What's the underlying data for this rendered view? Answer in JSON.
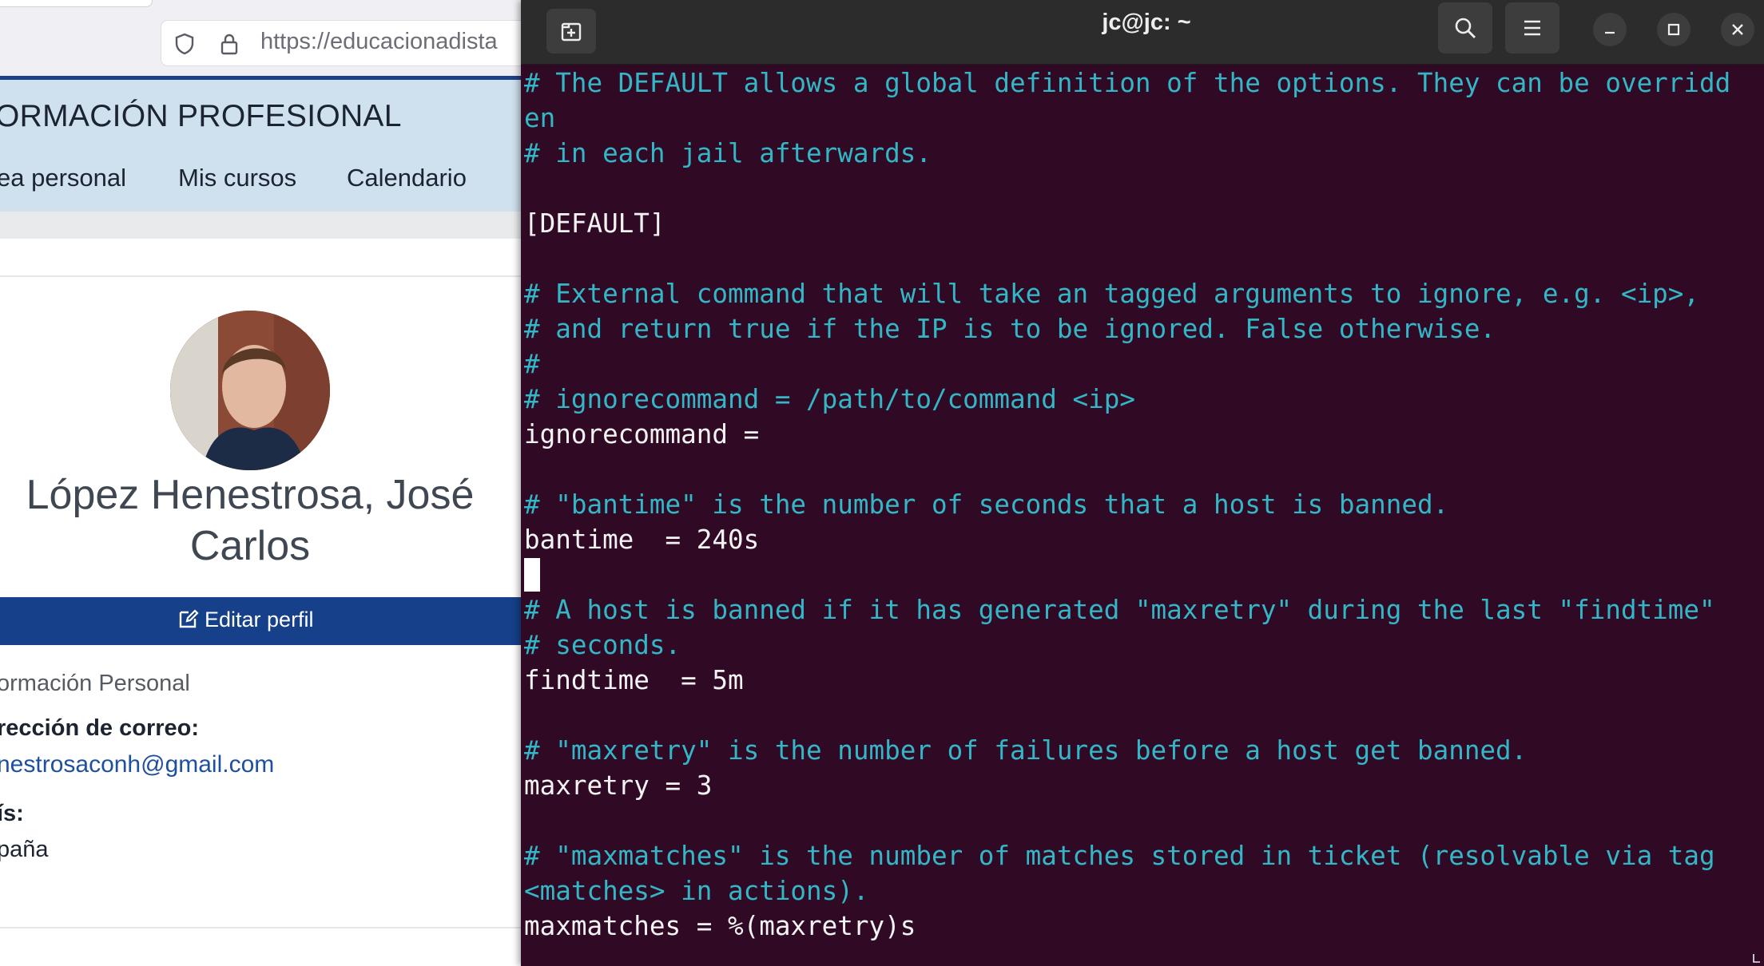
{
  "browser": {
    "url": "https://educacionadista",
    "site_title": "ORMACIÓN PROFESIONAL",
    "nav_items": [
      "ea personal",
      "Mis cursos",
      "Calendario"
    ],
    "profile_name": "López Henestrosa, José Carlos",
    "edit_profile_label": "Editar perfil",
    "section_title": "ormación Personal",
    "email_label": "rección de correo:",
    "email_value": "nestrosaconh@gmail.com",
    "country_label": "ís:",
    "country_value": "paña"
  },
  "terminal": {
    "title": "jc@jc: ~",
    "lines": [
      {
        "text": "# The DEFAULT allows a global definition of the options. They can be overridd",
        "type": "comment"
      },
      {
        "text": "en",
        "type": "comment"
      },
      {
        "text": "# in each jail afterwards.",
        "type": "comment"
      },
      {
        "text": "",
        "type": "blank"
      },
      {
        "text": "[DEFAULT]",
        "type": "text"
      },
      {
        "text": "",
        "type": "blank"
      },
      {
        "text": "# External command that will take an tagged arguments to ignore, e.g. <ip>,",
        "type": "comment"
      },
      {
        "text": "# and return true if the IP is to be ignored. False otherwise.",
        "type": "comment"
      },
      {
        "text": "#",
        "type": "comment"
      },
      {
        "text": "# ignorecommand = /path/to/command <ip>",
        "type": "comment"
      },
      {
        "text": "ignorecommand =",
        "type": "text"
      },
      {
        "text": "",
        "type": "blank"
      },
      {
        "text": "# \"bantime\" is the number of seconds that a host is banned.",
        "type": "comment"
      },
      {
        "text": "bantime  = 240s",
        "type": "text"
      },
      {
        "text": "",
        "type": "cursor"
      },
      {
        "text": "# A host is banned if it has generated \"maxretry\" during the last \"findtime\"",
        "type": "comment"
      },
      {
        "text": "# seconds.",
        "type": "comment"
      },
      {
        "text": "findtime  = 5m",
        "type": "text"
      },
      {
        "text": "",
        "type": "blank"
      },
      {
        "text": "# \"maxretry\" is the number of failures before a host get banned.",
        "type": "comment"
      },
      {
        "text": "maxretry = 3",
        "type": "text"
      },
      {
        "text": "",
        "type": "blank"
      },
      {
        "text": "# \"maxmatches\" is the number of matches stored in ticket (resolvable via tag",
        "type": "comment"
      },
      {
        "text": "<matches> in actions).",
        "type": "comment"
      },
      {
        "text": "maxmatches = %(maxretry)s",
        "type": "text"
      }
    ]
  },
  "colors": {
    "terminal_bg": "#300a24",
    "comment": "#33b6c6",
    "text": "#f3f3f3",
    "nav_bg": "#cfe0ee",
    "accent": "#16408a"
  },
  "icons": [
    "new-tab-icon",
    "search-icon",
    "hamburger-menu-icon",
    "minimize-icon",
    "maximize-icon",
    "close-icon",
    "shield-icon",
    "lock-icon",
    "edit-icon"
  ]
}
